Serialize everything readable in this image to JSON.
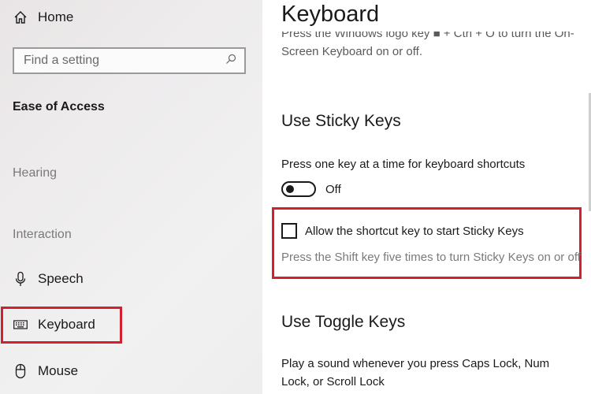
{
  "sidebar": {
    "home_label": "Home",
    "search_placeholder": "Find a setting",
    "section_title": "Ease of Access",
    "groups": {
      "hearing": "Hearing",
      "interaction": "Interaction"
    },
    "items": [
      {
        "label": "Speech",
        "icon": "microphone-icon"
      },
      {
        "label": "Keyboard",
        "icon": "keyboard-icon",
        "highlighted": true
      },
      {
        "label": "Mouse",
        "icon": "mouse-icon"
      }
    ]
  },
  "main": {
    "title": "Keyboard",
    "onscreen_desc_line1": "Press the Windows logo key ■ + Ctrl + O to turn the On-",
    "onscreen_desc_line2": "Screen Keyboard on or off.",
    "sticky": {
      "heading": "Use Sticky Keys",
      "description": "Press one key at a time for keyboard shortcuts",
      "toggle_state": "Off",
      "checkbox_label": "Allow the shortcut key to start Sticky Keys",
      "checkbox_checked": false,
      "checkbox_hint": "Press the Shift key five times to turn Sticky Keys on or off"
    },
    "toggle_keys": {
      "heading": "Use Toggle Keys",
      "description": "Play a sound whenever you press Caps Lock, Num Lock, or Scroll Lock"
    }
  },
  "colors": {
    "highlight": "#d2202e",
    "muted_text": "#7a7a7a"
  }
}
